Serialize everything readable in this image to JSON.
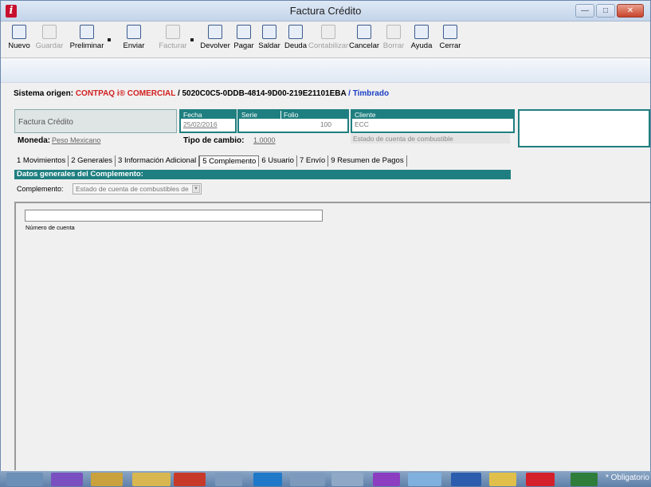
{
  "window": {
    "title": "Factura Crédito"
  },
  "toolbar": [
    {
      "label": "Nuevo",
      "icon": "new-icon",
      "enabled": true
    },
    {
      "label": "Guardar",
      "icon": "save-icon",
      "enabled": false
    },
    {
      "label": "Preliminar",
      "icon": "preview-icon",
      "enabled": true
    },
    {
      "label": "Enviar",
      "icon": "send-icon",
      "enabled": true
    },
    {
      "label": "Facturar",
      "icon": "invoice-icon",
      "enabled": false
    },
    {
      "label": "Devolver",
      "icon": "return-icon",
      "enabled": true
    },
    {
      "label": "Pagar",
      "icon": "pay-icon",
      "enabled": true
    },
    {
      "label": "Saldar",
      "icon": "settle-icon",
      "enabled": true
    },
    {
      "label": "Deuda",
      "icon": "debt-icon",
      "enabled": true
    },
    {
      "label": "Contabilizar",
      "icon": "accounting-icon",
      "enabled": false
    },
    {
      "label": "Cancelar",
      "icon": "cancel-icon",
      "enabled": true
    },
    {
      "label": "Borrar",
      "icon": "delete-icon",
      "enabled": false
    },
    {
      "label": "Ayuda",
      "icon": "help-icon",
      "enabled": true
    },
    {
      "label": "Cerrar",
      "icon": "close-door-icon",
      "enabled": true
    }
  ],
  "origin": {
    "prefix": "Sistema origen:",
    "system": "CONTPAQ i® COMERCIAL",
    "uuid": "/ 5020C0C5-0DDB-4814-9D00-219E21101EBA",
    "status": "/ Timbrado"
  },
  "document": {
    "type": "Factura Crédito",
    "fecha_label": "Fecha",
    "fecha": "25/02/2016",
    "serie_label": "Serie",
    "serie": "",
    "folio_label": "Folio",
    "folio": "100",
    "cliente_label": "Cliente",
    "cliente_code": "ECC",
    "cliente_name": "Estado de cuenta de combustible",
    "moneda_label": "Moneda:",
    "moneda": "Peso Mexicano",
    "tipo_cambio_label": "Tipo de cambio:",
    "tipo_cambio": "1.0000"
  },
  "tabs": [
    {
      "label": "1 Movimientos",
      "active": false
    },
    {
      "label": "2 Generales",
      "active": false
    },
    {
      "label": "3 Información Adicional",
      "active": false
    },
    {
      "label": "5 Complemento",
      "active": true
    },
    {
      "label": "6 Usuario",
      "active": false
    },
    {
      "label": "7 Envío",
      "active": false
    },
    {
      "label": "9 Resumen de Pagos",
      "active": false
    }
  ],
  "complemento": {
    "section_title": "Datos generales del Complemento:",
    "label": "Complemento:",
    "selected": "Estado de cuenta de combustibles de",
    "numero_cuenta_label": "Número de cuenta",
    "numero_cuenta": ""
  },
  "taskbar": {
    "text": "* Obligatorio"
  },
  "colors": {
    "teal": "#1f7f80",
    "red": "#d21f1f",
    "blue": "#1a3fc4"
  }
}
